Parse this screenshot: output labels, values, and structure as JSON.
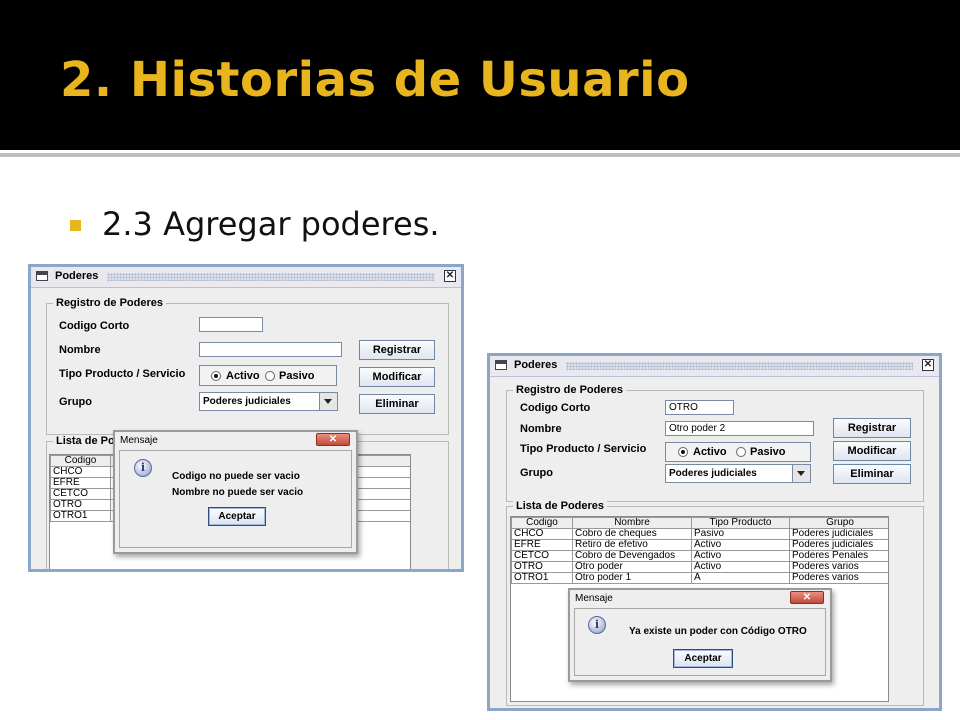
{
  "slide": {
    "title": "2. Historias de Usuario",
    "bullet": "2.3 Agregar poderes.",
    "accent_color": "#e9b51f"
  },
  "window_left": {
    "title": "Poderes",
    "form": {
      "legend": "Registro de Poderes",
      "codigo_label": "Codigo Corto",
      "codigo_value": "",
      "nombre_label": "Nombre",
      "nombre_value": "",
      "tipo_label": "Tipo Producto / Servicio",
      "radio_activo": "Activo",
      "radio_pasivo": "Pasivo",
      "grupo_label": "Grupo",
      "grupo_value": "Poderes judiciales"
    },
    "buttons": {
      "registrar": "Registrar",
      "modificar": "Modificar",
      "eliminar": "Eliminar"
    },
    "list": {
      "legend": "Lista de Pode",
      "headers": [
        "Codigo",
        "",
        "",
        "rupo"
      ],
      "rows": [
        [
          "CHCO",
          "C",
          "",
          "judiciales"
        ],
        [
          "EFRE",
          "R",
          "",
          "s judiciales"
        ],
        [
          "CETCO",
          "C",
          "",
          "s Penales"
        ],
        [
          "OTRO",
          "C",
          "",
          "s varios"
        ],
        [
          "OTRO1",
          "C",
          "",
          "s varios"
        ]
      ]
    },
    "dialog": {
      "title": "Mensaje",
      "line1": "Codigo no puede ser vacio",
      "line2": "Nombre no puede ser vacio",
      "button": "Aceptar"
    }
  },
  "window_right": {
    "title": "Poderes",
    "form": {
      "legend": "Registro de Poderes",
      "codigo_label": "Codigo Corto",
      "codigo_value": "OTRO",
      "nombre_label": "Nombre",
      "nombre_value": "Otro poder 2",
      "tipo_label": "Tipo Producto / Servicio",
      "radio_activo": "Activo",
      "radio_pasivo": "Pasivo",
      "grupo_label": "Grupo",
      "grupo_value": "Poderes judiciales"
    },
    "buttons": {
      "registrar": "Registrar",
      "modificar": "Modificar",
      "eliminar": "Eliminar"
    },
    "list": {
      "legend": "Lista de Poderes",
      "headers": [
        "Codigo",
        "Nombre",
        "Tipo Producto",
        "Grupo"
      ],
      "rows": [
        [
          "CHCO",
          "Cobro de cheques",
          "Pasivo",
          "Poderes judiciales"
        ],
        [
          "EFRE",
          "Retiro de efetivo",
          "Activo",
          "Poderes judiciales"
        ],
        [
          "CETCO",
          "Cobro de Devengados",
          "Activo",
          "Poderes Penales"
        ],
        [
          "OTRO",
          "Otro poder",
          "Activo",
          "Poderes varios"
        ],
        [
          "OTRO1",
          "Otro poder 1",
          "A",
          "Poderes varios"
        ]
      ]
    },
    "dialog": {
      "title": "Mensaje",
      "line1": "Ya existe un poder con Código OTRO",
      "button": "Aceptar"
    }
  }
}
